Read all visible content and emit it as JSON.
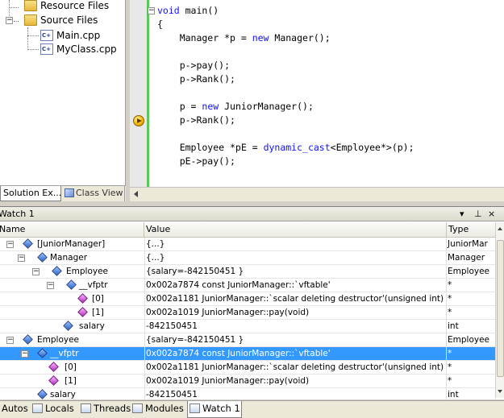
{
  "solution_explorer": {
    "items": [
      {
        "label": "Resource Files",
        "icon": "folder-icon"
      },
      {
        "label": "Source Files",
        "icon": "folder-open-icon"
      },
      {
        "label": "Main.cpp",
        "icon": "cpp-file-icon"
      },
      {
        "label": "MyClass.cpp",
        "icon": "cpp-file-icon"
      }
    ],
    "tabs": [
      {
        "label": "Solution Ex..."
      },
      {
        "label": "Class View"
      }
    ]
  },
  "editor": {
    "lines": [
      {
        "parts": [
          {
            "t": "void",
            "kw": true
          },
          {
            "t": " main()"
          }
        ]
      },
      {
        "parts": [
          {
            "t": "{"
          }
        ]
      },
      {
        "parts": [
          {
            "t": "    Manager *p = "
          },
          {
            "t": "new",
            "kw": true
          },
          {
            "t": " Manager();"
          }
        ]
      },
      {
        "parts": []
      },
      {
        "parts": [
          {
            "t": "    p->pay();"
          }
        ]
      },
      {
        "parts": [
          {
            "t": "    p->Rank();"
          }
        ]
      },
      {
        "parts": []
      },
      {
        "parts": [
          {
            "t": "    p = "
          },
          {
            "t": "new",
            "kw": true
          },
          {
            "t": " JuniorManager();"
          }
        ]
      },
      {
        "parts": [
          {
            "t": "    p->Rank();"
          }
        ]
      },
      {
        "parts": []
      },
      {
        "parts": [
          {
            "t": "    Employee *pE = "
          },
          {
            "t": "dynamic_cast",
            "kw": true
          },
          {
            "t": "<Employee*>(p);"
          }
        ]
      },
      {
        "parts": [
          {
            "t": "    pE->pay();"
          }
        ]
      }
    ],
    "current_line_icon": "current-statement-arrow-icon",
    "colors": {
      "keyword": "#1010ff",
      "margin_marker": "#5bc85b"
    }
  },
  "watch": {
    "title": "Watch 1",
    "controls": [
      "▾",
      "⊥",
      "×"
    ],
    "columns": {
      "name": "Name",
      "value": "Value",
      "type": "Type"
    },
    "rows": [
      {
        "name": "[JuniorManager]",
        "value": "{...}",
        "type": "JuniorMar",
        "icon": "field-icon"
      },
      {
        "name": "Manager",
        "value": "{...}",
        "type": "Manager",
        "icon": "field-icon"
      },
      {
        "name": "Employee",
        "value": "{salary=-842150451 }",
        "type": "Employee",
        "icon": "field-icon"
      },
      {
        "name": "__vfptr",
        "value": "0x002a7874 const JuniorManager::`vftable'",
        "type": "*",
        "icon": "field-icon"
      },
      {
        "name": "[0]",
        "value": "0x002a1181 JuniorManager::`scalar deleting destructor'(unsigned int)",
        "type": "*",
        "icon": "method-icon"
      },
      {
        "name": "[1]",
        "value": "0x002a1019 JuniorManager::pay(void)",
        "type": "*",
        "icon": "method-icon"
      },
      {
        "name": "salary",
        "value": "-842150451",
        "type": "int",
        "icon": "field-icon"
      },
      {
        "name": "Employee",
        "value": "{salary=-842150451 }",
        "type": "Employee",
        "icon": "field-icon"
      },
      {
        "name": "__vfptr",
        "value": "0x002a7874 const JuniorManager::`vftable'",
        "type": "*",
        "icon": "field-icon"
      },
      {
        "name": "[0]",
        "value": "0x002a1181 JuniorManager::`scalar deleting destructor'(unsigned int)",
        "type": "*",
        "icon": "method-icon"
      },
      {
        "name": "[1]",
        "value": "0x002a1019 JuniorManager::pay(void)",
        "type": "*",
        "icon": "method-icon"
      },
      {
        "name": "salary",
        "value": "-842150451",
        "type": "int",
        "icon": "field-icon"
      }
    ],
    "selected_color": "#3399ff"
  },
  "bottom_tabs": [
    {
      "label": "Autos",
      "icon": "autos-icon"
    },
    {
      "label": "Locals",
      "icon": "locals-icon"
    },
    {
      "label": "Threads",
      "icon": "threads-icon"
    },
    {
      "label": "Modules",
      "icon": "modules-icon"
    },
    {
      "label": "Watch 1",
      "icon": "watch-icon"
    }
  ]
}
